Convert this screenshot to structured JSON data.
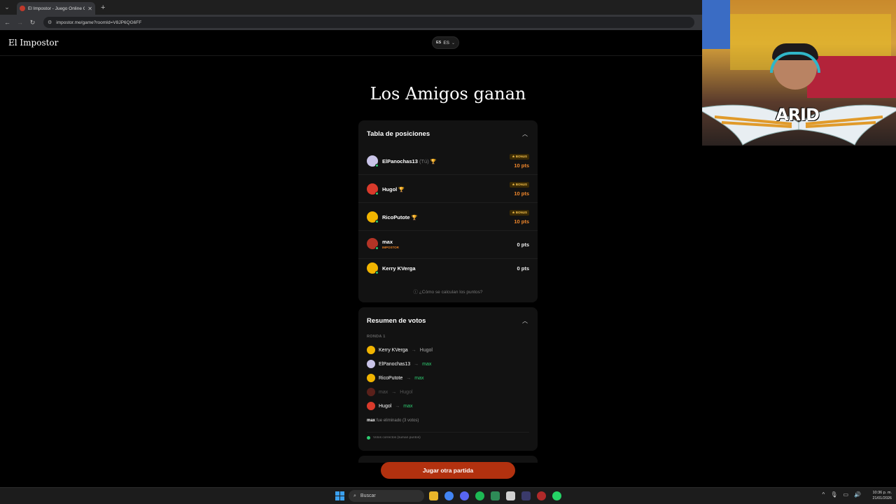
{
  "browser": {
    "tab_title": "El Impostor - Juego Online Gra",
    "url": "impostor.me/game?roomId=V8JP6QG6FF"
  },
  "site": {
    "brand": "El Impostor",
    "lang_flag": "ES",
    "lang_code": "ES"
  },
  "result_title": "Los Amigos ganan",
  "leaderboard": {
    "heading": "Tabla de posiciones",
    "bonus_label": "★ BONUS",
    "players": [
      {
        "name": "ElPanochas13",
        "tag": "(Tú)",
        "trophy": true,
        "bonus": true,
        "points": "10 pts",
        "avatar_color": "#c9c4e8"
      },
      {
        "name": "Hugol",
        "tag": "",
        "trophy": true,
        "bonus": true,
        "points": "10 pts",
        "avatar_color": "#d93a2b"
      },
      {
        "name": "RicoPutote",
        "tag": "",
        "trophy": true,
        "bonus": true,
        "points": "10 pts",
        "avatar_color": "#f1b400"
      },
      {
        "name": "max",
        "tag": "",
        "role": "IMPOSTOR",
        "trophy": false,
        "bonus": false,
        "points": "0 pts",
        "avatar_color": "#b33426"
      },
      {
        "name": "Kerry KVerga",
        "tag": "",
        "trophy": false,
        "bonus": false,
        "points": "0 pts",
        "avatar_color": "#f1b400"
      }
    ],
    "how_link": "¿Cómo se calculan los puntos?"
  },
  "votes": {
    "heading": "Resumen de votos",
    "round_label": "RONDA 1",
    "rows": [
      {
        "voter": "Kerry KVerga",
        "target": "Hugol",
        "correct": false,
        "dim": false,
        "avatar_color": "#f1b400"
      },
      {
        "voter": "ElPanochas13",
        "target": "max",
        "correct": true,
        "dim": false,
        "avatar_color": "#c9c4e8"
      },
      {
        "voter": "RicoPutote",
        "target": "max",
        "correct": true,
        "dim": false,
        "avatar_color": "#f1b400"
      },
      {
        "voter": "max",
        "target": "Hugol",
        "correct": false,
        "dim": true,
        "avatar_color": "#b33426"
      },
      {
        "voter": "Hugol",
        "target": "max",
        "correct": true,
        "dim": false,
        "avatar_color": "#d93a2b"
      }
    ],
    "eliminated_name": "max",
    "eliminated_text": "fue eliminado (3 votos)",
    "legend": "Votos correctos (suman puntos)"
  },
  "play_again": "Jugar otra partida",
  "webcam": {
    "logo": "ARID"
  },
  "taskbar": {
    "search": "Buscar",
    "time": "10:36 p. m.",
    "date": "21/01/2026"
  },
  "colors": {
    "accent_orange": "#f0872b",
    "button": "#b2310f",
    "correct_green": "#2ecc71"
  }
}
